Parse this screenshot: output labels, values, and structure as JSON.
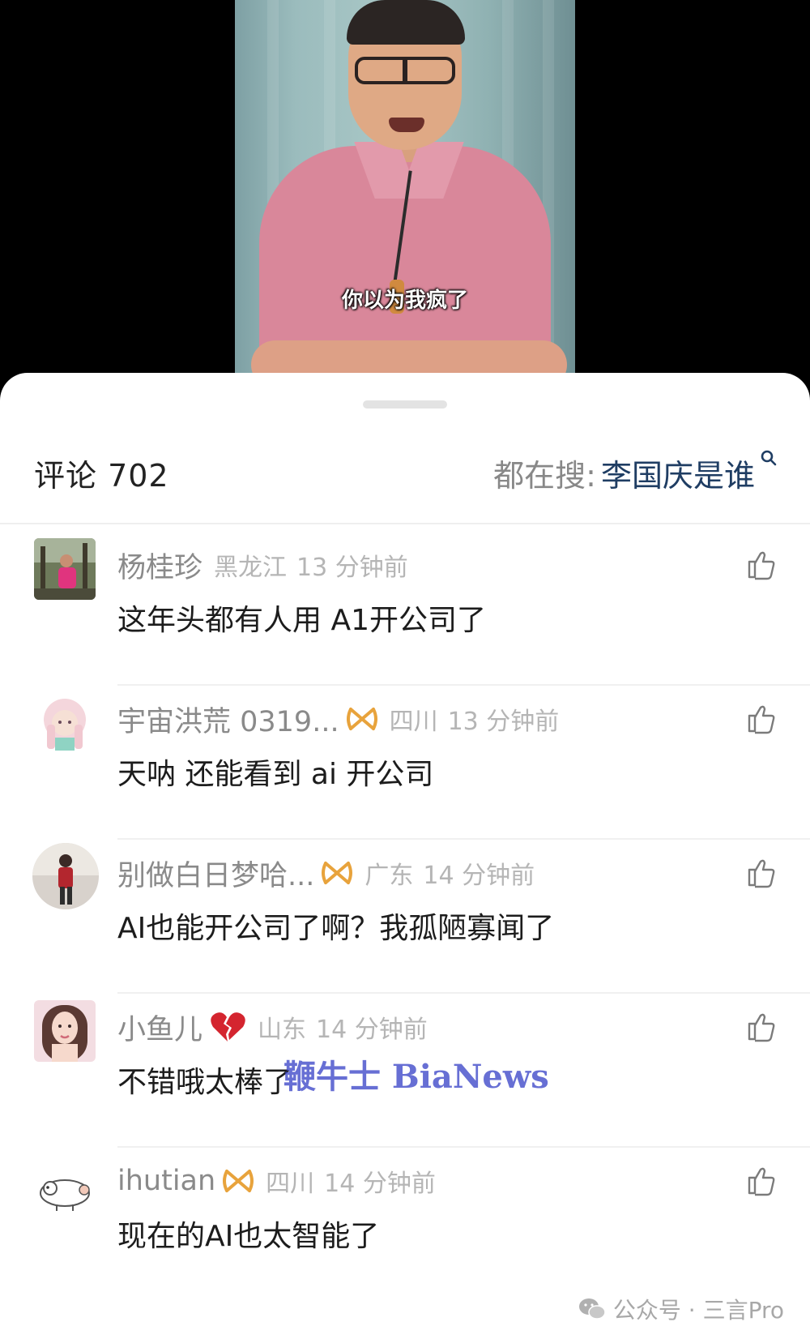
{
  "video": {
    "subtitle": "你以为我疯了"
  },
  "sheet": {
    "comment_count": "评论 702",
    "trending_label": "都在搜:",
    "trending_query": "李国庆是谁"
  },
  "comments": [
    {
      "username": "杨桂珍",
      "location": "黑龙江",
      "time": "13 分钟前",
      "text": "这年头都有人用 A1开公司了",
      "avatar": "woman-in-pink-photo"
    },
    {
      "username": "宇宙洪荒 0319...",
      "location": "四川",
      "time": "13 分钟前",
      "text": "天呐 还能看到 ai 开公司",
      "avatar": "anime-girl-illustration"
    },
    {
      "username": "别做白日梦哈...",
      "location": "广东",
      "time": "14 分钟前",
      "text": "AI也能开公司了啊？我孤陋寡闻了",
      "avatar": "woman-in-red-photo"
    },
    {
      "username": "小鱼儿",
      "location": "山东",
      "time": "14 分钟前",
      "text": "不错哦太棒了",
      "avatar": "woman-portrait-photo"
    },
    {
      "username": "ihutian",
      "location": "四川",
      "time": "14 分钟前",
      "text": "现在的AI也太智能了",
      "avatar": "cartoon-sheep-illustration"
    }
  ],
  "watermark": "鞭牛士 BiaNews",
  "footer": {
    "source": "公众号 · 三言Pro"
  },
  "colors": {
    "trending_query": "#1f3d63",
    "badge": "#e8a33c",
    "watermark": "#3c46c8"
  }
}
